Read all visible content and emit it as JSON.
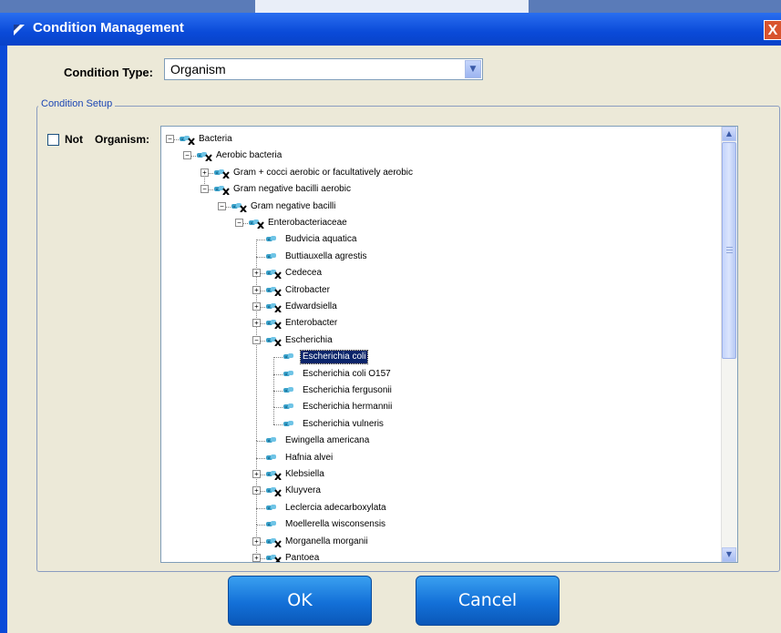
{
  "window": {
    "title": "Condition Management",
    "close_glyph": "X"
  },
  "condition_type": {
    "label": "Condition Type:",
    "value": "Organism"
  },
  "condition_setup": {
    "legend": "Condition Setup",
    "not_label": "Not",
    "not_checked": false,
    "organism_label": "Organism:"
  },
  "tree": {
    "items": [
      {
        "label": "Bacteria",
        "level": 0,
        "expander": "-",
        "icon": "organism-x-icon"
      },
      {
        "label": "Aerobic bacteria",
        "level": 1,
        "expander": "-",
        "icon": "organism-x-icon"
      },
      {
        "label": "Gram + cocci aerobic or facultatively aerobic",
        "level": 2,
        "expander": "+",
        "icon": "organism-x-icon"
      },
      {
        "label": "Gram negative bacilli aerobic",
        "level": 2,
        "expander": "-",
        "icon": "organism-x-icon"
      },
      {
        "label": "Gram negative bacilli",
        "level": 3,
        "expander": "-",
        "icon": "organism-x-icon"
      },
      {
        "label": "Enterobacteriaceae",
        "level": 4,
        "expander": "-",
        "icon": "organism-x-icon"
      },
      {
        "label": "Budvicia aquatica",
        "level": 5,
        "expander": "",
        "icon": "organism-icon"
      },
      {
        "label": "Buttiauxella agrestis",
        "level": 5,
        "expander": "",
        "icon": "organism-icon"
      },
      {
        "label": "Cedecea",
        "level": 5,
        "expander": "+",
        "icon": "organism-x-icon"
      },
      {
        "label": "Citrobacter",
        "level": 5,
        "expander": "+",
        "icon": "organism-x-icon"
      },
      {
        "label": "Edwardsiella",
        "level": 5,
        "expander": "+",
        "icon": "organism-x-icon"
      },
      {
        "label": "Enterobacter",
        "level": 5,
        "expander": "+",
        "icon": "organism-x-icon"
      },
      {
        "label": "Escherichia",
        "level": 5,
        "expander": "-",
        "icon": "organism-x-icon"
      },
      {
        "label": "Escherichia coli",
        "level": 6,
        "expander": "",
        "icon": "organism-icon",
        "selected": true
      },
      {
        "label": "Escherichia coli O157",
        "level": 6,
        "expander": "",
        "icon": "organism-icon"
      },
      {
        "label": "Escherichia fergusonii",
        "level": 6,
        "expander": "",
        "icon": "organism-icon"
      },
      {
        "label": "Escherichia hermannii",
        "level": 6,
        "expander": "",
        "icon": "organism-icon"
      },
      {
        "label": "Escherichia vulneris",
        "level": 6,
        "expander": "",
        "icon": "organism-icon"
      },
      {
        "label": "Ewingella americana",
        "level": 5,
        "expander": "",
        "icon": "organism-icon"
      },
      {
        "label": "Hafnia alvei",
        "level": 5,
        "expander": "",
        "icon": "organism-icon"
      },
      {
        "label": "Klebsiella",
        "level": 5,
        "expander": "+",
        "icon": "organism-x-icon"
      },
      {
        "label": "Kluyvera",
        "level": 5,
        "expander": "+",
        "icon": "organism-x-icon"
      },
      {
        "label": "Leclercia adecarboxylata",
        "level": 5,
        "expander": "",
        "icon": "organism-icon"
      },
      {
        "label": "Moellerella wisconsensis",
        "level": 5,
        "expander": "",
        "icon": "organism-icon"
      },
      {
        "label": "Morganella morganii",
        "level": 5,
        "expander": "+",
        "icon": "organism-x-icon"
      },
      {
        "label": "Pantoea",
        "level": 5,
        "expander": "+",
        "icon": "organism-x-icon"
      }
    ]
  },
  "buttons": {
    "ok": "OK",
    "cancel": "Cancel"
  },
  "colors": {
    "title_bar": "#0a4ad8",
    "dialog_bg": "#ece9d8",
    "selection": "#0a246a",
    "button": "#1370d8"
  }
}
